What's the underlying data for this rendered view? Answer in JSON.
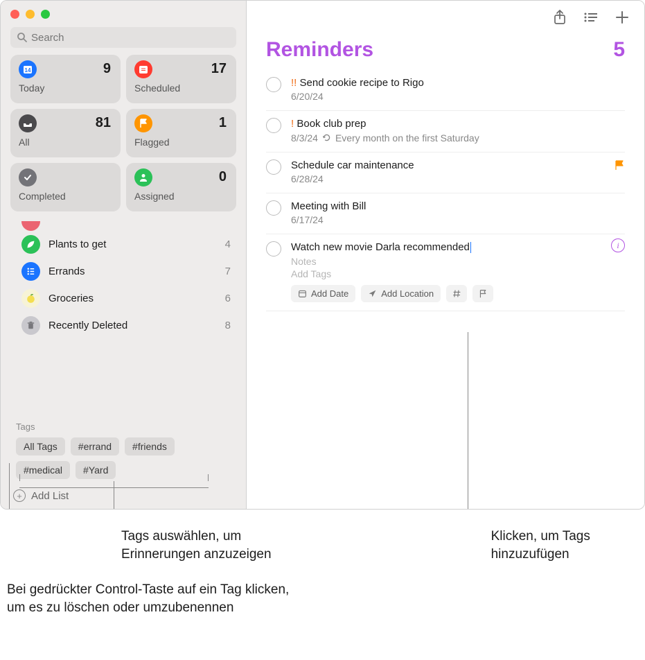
{
  "search": {
    "placeholder": "Search"
  },
  "smart": [
    {
      "label": "Today",
      "count": "9",
      "icon_bg": "#1a74ff",
      "icon": "calendar"
    },
    {
      "label": "Scheduled",
      "count": "17",
      "icon_bg": "#ff3b30",
      "icon": "calendar"
    },
    {
      "label": "All",
      "count": "81",
      "icon_bg": "#4a494c",
      "icon": "tray"
    },
    {
      "label": "Flagged",
      "count": "1",
      "icon_bg": "#ff9500",
      "icon": "flag"
    },
    {
      "label": "Completed",
      "count": "",
      "icon_bg": "#737378",
      "icon": "check"
    },
    {
      "label": "Assigned",
      "count": "0",
      "icon_bg": "#2bc158",
      "icon": "person"
    }
  ],
  "lists": [
    {
      "name": "Plants to get",
      "count": "4",
      "color": "#2bc158",
      "icon": "leaf"
    },
    {
      "name": "Errands",
      "count": "7",
      "color": "#1a74ff",
      "icon": "list"
    },
    {
      "name": "Groceries",
      "count": "6",
      "color": "#f7f3d6",
      "icon": "lemon"
    },
    {
      "name": "Recently Deleted",
      "count": "8",
      "color": "#c9c8cd",
      "icon": "trash"
    }
  ],
  "tags_header": "Tags",
  "tags": [
    "All Tags",
    "#errand",
    "#friends",
    "#medical",
    "#Yard"
  ],
  "add_list_label": "Add List",
  "list_title": "Reminders",
  "list_count": "5",
  "reminders": [
    {
      "priority": "!!",
      "title": "Send cookie recipe to Rigo",
      "date": "6/20/24"
    },
    {
      "priority": "!",
      "title": "Book club prep",
      "date": "8/3/24",
      "repeat": "Every month on the first Saturday"
    },
    {
      "title": "Schedule car maintenance",
      "date": "6/28/24",
      "flagged": true
    },
    {
      "title": "Meeting with Bill",
      "date": "6/17/24"
    },
    {
      "title": "Watch new movie Darla recommended",
      "editing": true,
      "notes_placeholder": "Notes",
      "tags_placeholder": "Add Tags"
    }
  ],
  "chips": {
    "add_date": "Add Date",
    "add_location": "Add Location"
  },
  "callouts": {
    "select_tags": "Tags auswählen, um Erinnerungen anzuzeigen",
    "click_add_tags": "Klicken, um Tags hinzuzufügen",
    "control_click": "Bei gedrückter Control-Taste auf ein Tag klicken, um es zu löschen oder umzubenennen"
  }
}
